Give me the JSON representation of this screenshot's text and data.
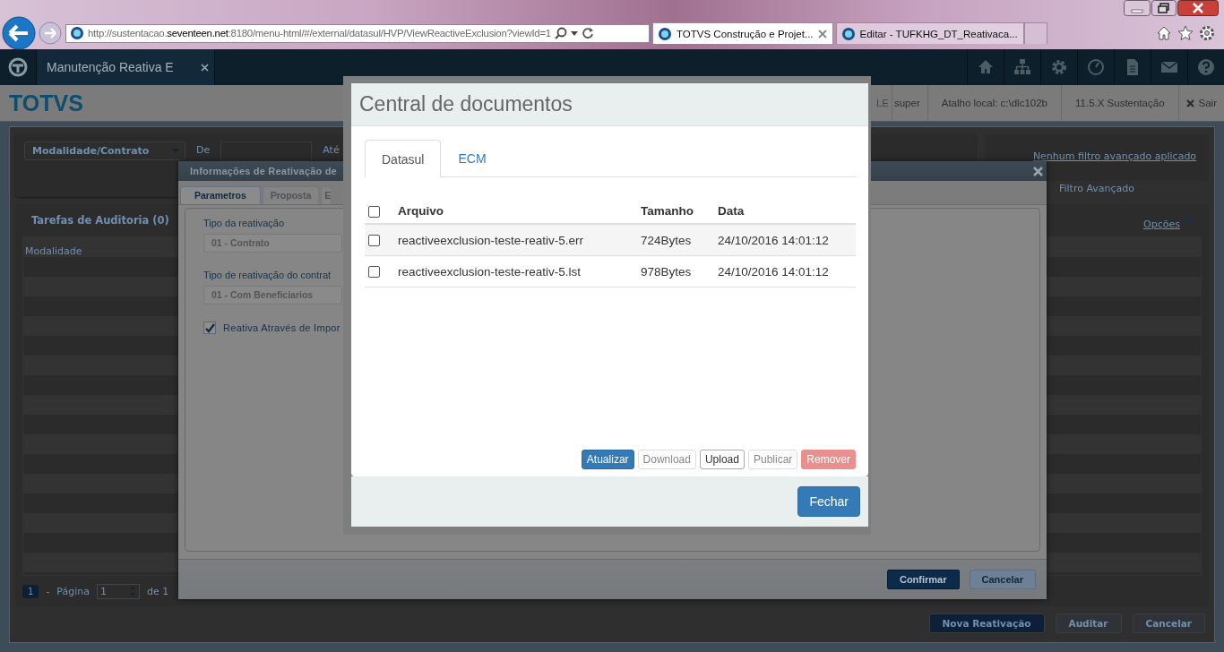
{
  "browser": {
    "url": "http://sustentacao.**seventeen.net**:8180/menu-html/#/external/datasul/HVP/ViewReactiveExclusion?viewId=1",
    "tabs": [
      {
        "title": "TOTVS Construção e Projet...",
        "selected": true
      },
      {
        "title": "Editar - TUFKHG_DT_Reativaca...",
        "selected": false
      }
    ]
  },
  "app_bar": {
    "tab": "Manutenção Reativa E"
  },
  "header": {
    "brand": "TOTVS",
    "items": [
      "LE",
      "super",
      "Atalho local: c:\\dlc102b",
      "11.5.X Sustentação"
    ],
    "logout": "Sair"
  },
  "page": {
    "filter": {
      "select": "Modalidade/Contrato",
      "from_label": "De",
      "to_label": "Até"
    },
    "advanced": {
      "link": "Nenhum filtro avançado aplicado",
      "title": "Filtro Avançado"
    },
    "list": {
      "title": "Tarefas de Auditoria (0)",
      "column": "Modalidade",
      "options": "Opções"
    },
    "pagination": {
      "page": "1",
      "separator": "-",
      "label": "Página",
      "input": "1",
      "suffix": "de 1"
    },
    "buttons": [
      "Nova Reativação",
      "Auditar",
      "Cancelar"
    ]
  },
  "reactivation_dialog": {
    "title": "Informações de Reativação de",
    "tabs": [
      {
        "label": "Parametros",
        "selected": true
      },
      {
        "label": "Proposta",
        "selected": false
      },
      {
        "label": "E",
        "selected": false
      }
    ],
    "fields": [
      {
        "label": "Tipo da reativação",
        "value": "01 - Contrato"
      },
      {
        "label": "Tipo de reativação do contrat",
        "value": "01 - Com Beneficiarios"
      }
    ],
    "checkbox": {
      "label": "Reativa Através de Impor",
      "checked": true
    },
    "buttons": [
      {
        "label": "Confirmar",
        "kind": "primary"
      },
      {
        "label": "Cancelar",
        "kind": "default"
      }
    ]
  },
  "documents_modal": {
    "title": "Central de documentos",
    "tabs": [
      {
        "label": "Datasul",
        "selected": true
      },
      {
        "label": "ECM",
        "selected": false
      }
    ],
    "table": {
      "columns": [
        "Arquivo",
        "Tamanho",
        "Data"
      ],
      "all_checked": false,
      "rows": [
        {
          "checked": false,
          "file": "reactiveexclusion-teste-reativ-5.err",
          "size": "724Bytes",
          "date": "24/10/2016 14:01:12"
        },
        {
          "checked": false,
          "file": "reactiveexclusion-teste-reativ-5.lst",
          "size": "978Bytes",
          "date": "24/10/2016 14:01:12"
        }
      ]
    },
    "actions": [
      {
        "label": "Atualizar",
        "kind": "primary"
      },
      {
        "label": "Download",
        "kind": "disabled"
      },
      {
        "label": "Upload",
        "kind": "default"
      },
      {
        "label": "Publicar",
        "kind": "disabled"
      },
      {
        "label": "Remover",
        "kind": "danger"
      }
    ],
    "close_button": "Fechar"
  }
}
